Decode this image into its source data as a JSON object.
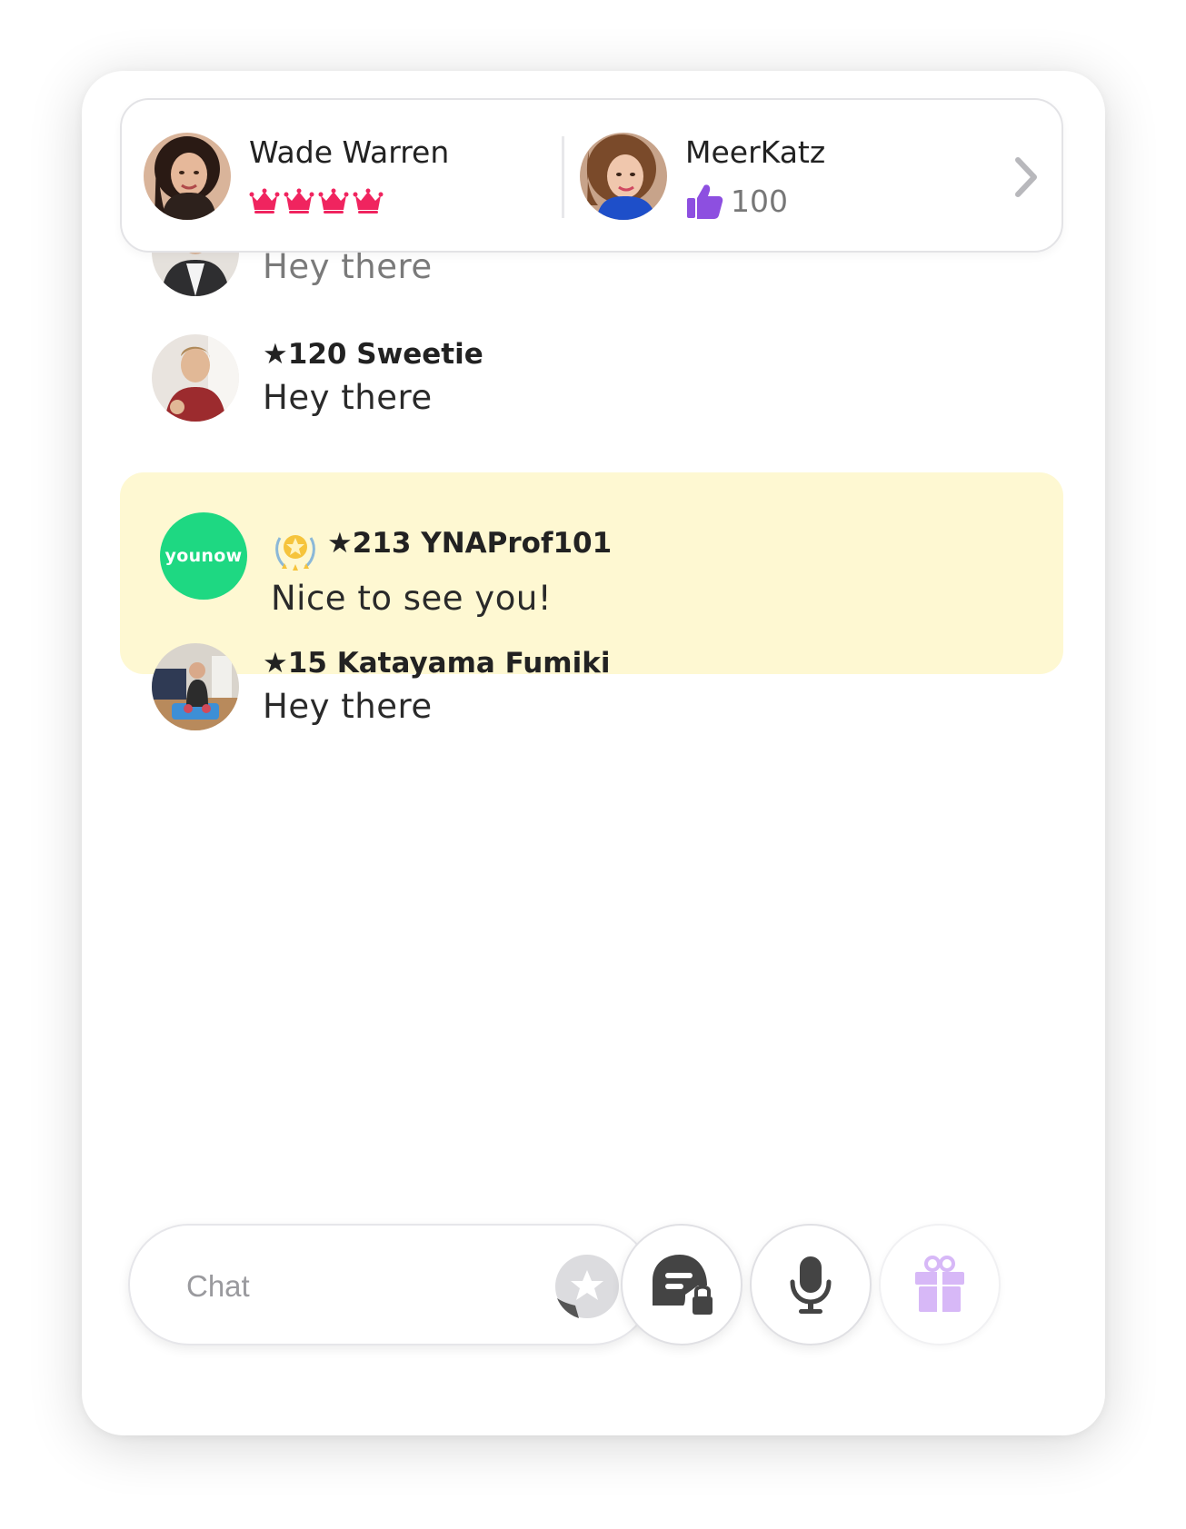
{
  "header": {
    "left": {
      "name": "Wade Warren",
      "crowns": 4
    },
    "right": {
      "name": "MeerKatz",
      "likes": "100"
    }
  },
  "messages": [
    {
      "name": "",
      "text": "Hey there"
    },
    {
      "name": "★120 Sweetie",
      "text": "Hey there"
    },
    {
      "name": "★213 YNAProf101",
      "text": "Nice to see you!",
      "avatar_label": "younow"
    },
    {
      "name": "★15 Katayama Fumiki",
      "text": "Hey there"
    }
  ],
  "composer": {
    "placeholder": "Chat"
  },
  "colors": {
    "brand_green": "#1ED882",
    "crown_pink": "#F0245F",
    "like_purple": "#8D4FE0",
    "gift_lilac": "#D7B8F7",
    "highlight_bg": "#FEF8D2"
  },
  "icons": [
    "crown-icon",
    "thumbs-up-icon",
    "chevron-right-icon",
    "sticker-icon",
    "chat-lock-icon",
    "microphone-icon",
    "gift-icon",
    "award-badge-icon"
  ]
}
